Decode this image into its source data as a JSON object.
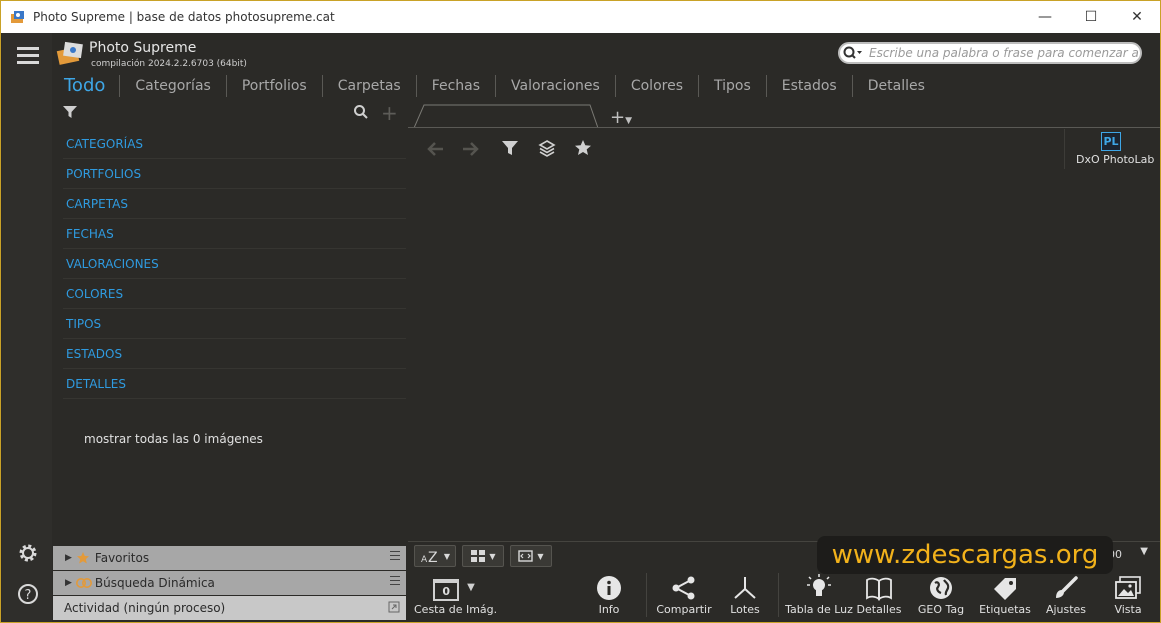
{
  "window": {
    "title": "Photo Supreme | base de datos photosupreme.cat",
    "controls": {
      "minimize": "—",
      "maximize": "☐",
      "close": "✕"
    }
  },
  "brand": {
    "name": "Photo Supreme",
    "version": "compilación 2024.2.2.6703 (64bit)"
  },
  "search": {
    "placeholder": "Escribe una palabra o frase para comenzar a buscar"
  },
  "tabs": [
    "Todo",
    "Categorías",
    "Portfolios",
    "Carpetas",
    "Fechas",
    "Valoraciones",
    "Colores",
    "Tipos",
    "Estados",
    "Detalles"
  ],
  "active_tab": "Todo",
  "left_panel": {
    "categories": [
      "CATEGORÍAS",
      "PORTFOLIOS",
      "CARPETAS",
      "FECHAS",
      "VALORACIONES",
      "COLORES",
      "TIPOS",
      "ESTADOS",
      "DETALLES"
    ],
    "show_all": "mostrar todas las 0 imágenes"
  },
  "accordion": {
    "favorites": "Favoritos",
    "dynamic_search": "Búsqueda Dinámica",
    "activity": "Actividad (ningún proceso)"
  },
  "external_editor": {
    "label": "DxO PhotoLab",
    "badge": "PL"
  },
  "sortbar": {
    "zoom": "100"
  },
  "watermark": "www.zdescargas.org",
  "dock": {
    "basket_count": "0",
    "items": [
      "Cesta de Imág.",
      "Info",
      "Compartir",
      "Lotes",
      "Tabla de Luz",
      "Detalles",
      "GEO Tag",
      "Etiquetas",
      "Ajustes",
      "Vista"
    ]
  },
  "colors": {
    "accent": "#3ea6e6",
    "background": "#2b2a27",
    "watermark": "#f2b21b"
  }
}
